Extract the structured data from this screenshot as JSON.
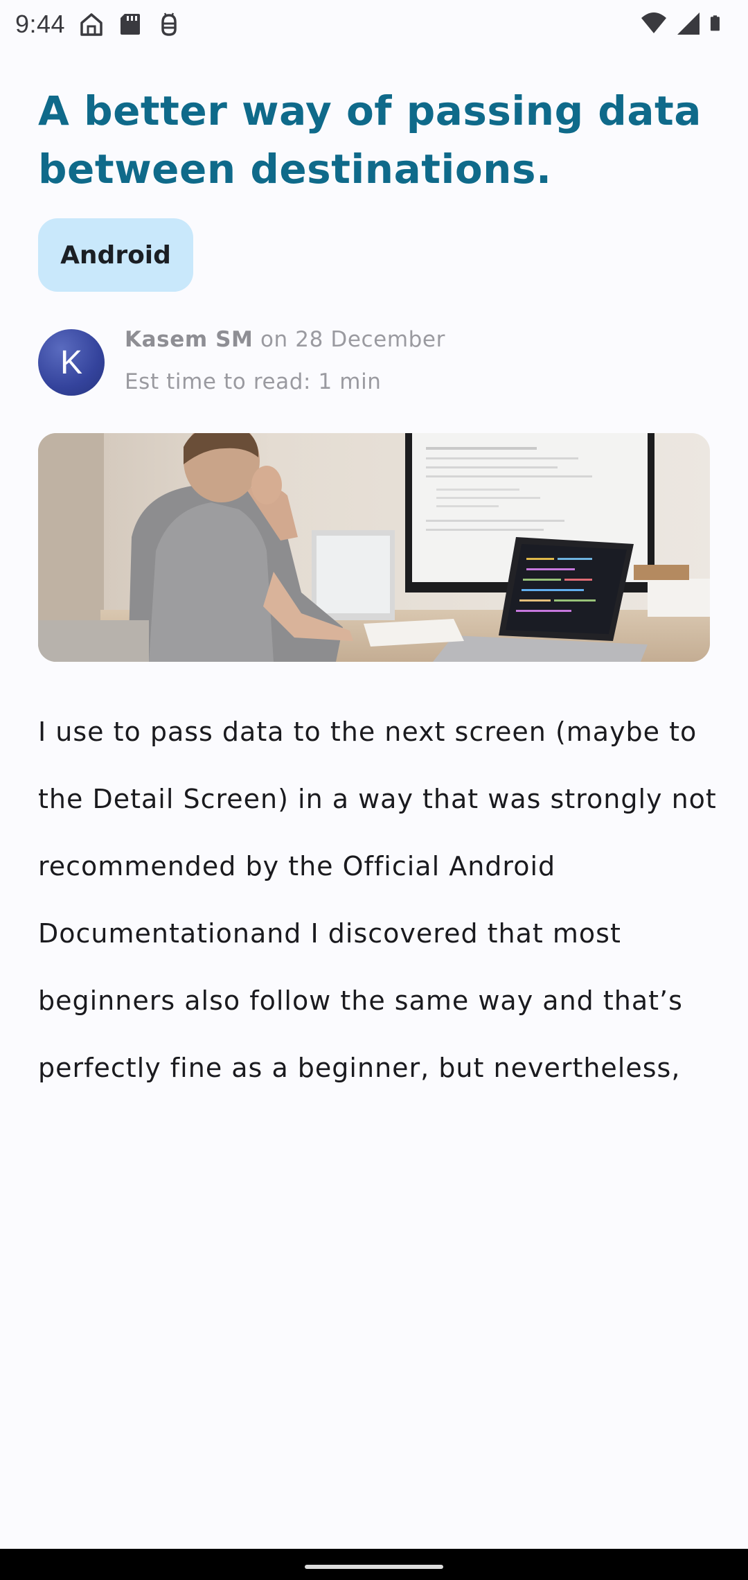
{
  "status_bar": {
    "time": "9:44",
    "left_icons": [
      "home-outline-icon",
      "sd-card-icon",
      "android-debug-icon"
    ],
    "right_icons": [
      "wifi-icon",
      "cell-signal-icon",
      "battery-icon"
    ]
  },
  "article": {
    "title": "A better way of passing data between destinations.",
    "tag": "Android",
    "author_initial": "K",
    "author": "Kasem SM",
    "date_prefix": "on",
    "date": "28 December",
    "read_time": "Est time to read: 1 min",
    "hero_image": "person-at-desk-with-computer-image",
    "body": "I use to pass data to the next screen (maybe to the Detail Screen) in a way that was strongly not recommended by the Official Android Documentationand I discovered that most beginners also follow the same way and that’s perfectly fine as a beginner, but nevertheless,"
  },
  "colors": {
    "title": "#0f6a8a",
    "tag_background": "#c9e8fb",
    "avatar": "#34439c",
    "meta_text": "#9a9aa0",
    "background": "#fbfbfe"
  }
}
